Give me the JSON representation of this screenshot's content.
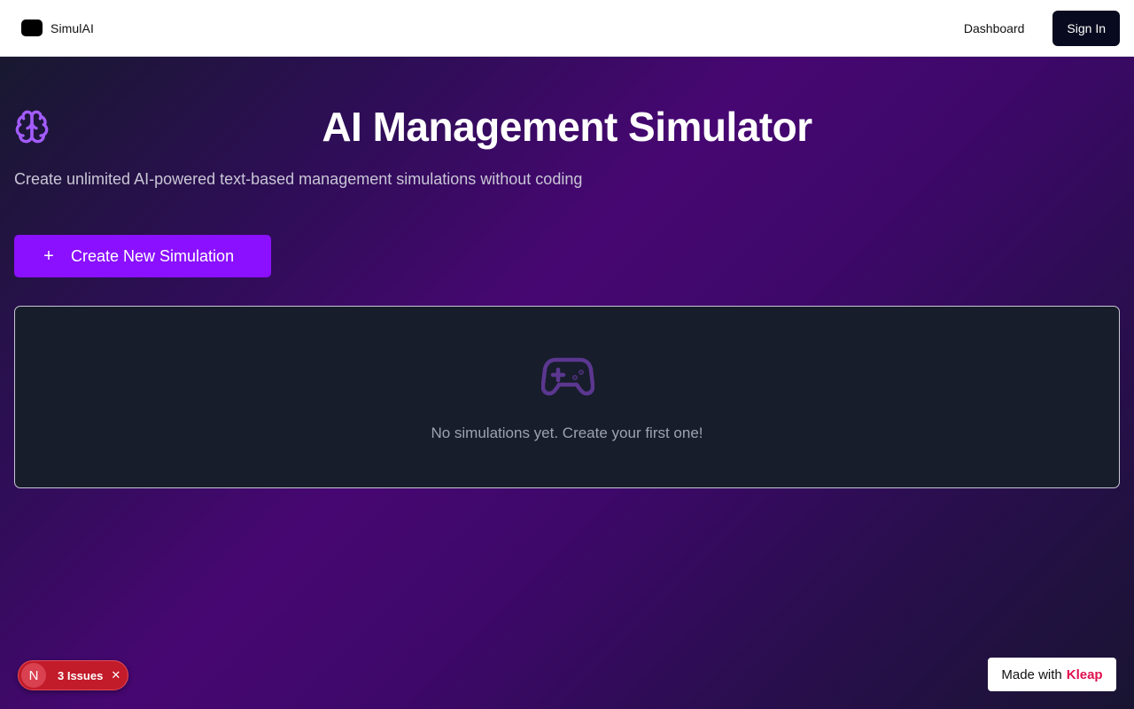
{
  "header": {
    "brand_name": "SimulAI",
    "nav_dashboard": "Dashboard",
    "sign_in_label": "Sign In"
  },
  "hero": {
    "icon": "brain-icon",
    "title": "AI Management Simulator",
    "subtitle": "Create unlimited AI-powered text-based management simulations without coding",
    "create_button_icon": "plus-icon",
    "create_button_label": "Create New Simulation"
  },
  "empty_state": {
    "icon": "gamepad-icon",
    "message": "No simulations yet. Create your first one!"
  },
  "dev_overlay": {
    "logo_letter": "N",
    "issues_label": "3 Issues",
    "close_icon": "close-icon"
  },
  "footer_badge": {
    "prefix": "Made with",
    "brand": "Kleap"
  },
  "colors": {
    "accent": "#8b10ff",
    "icon_purple": "#a35cff",
    "issues_red": "#c21b2a",
    "kleap_pink": "#e0104d",
    "card_bg": "#171d2b"
  }
}
